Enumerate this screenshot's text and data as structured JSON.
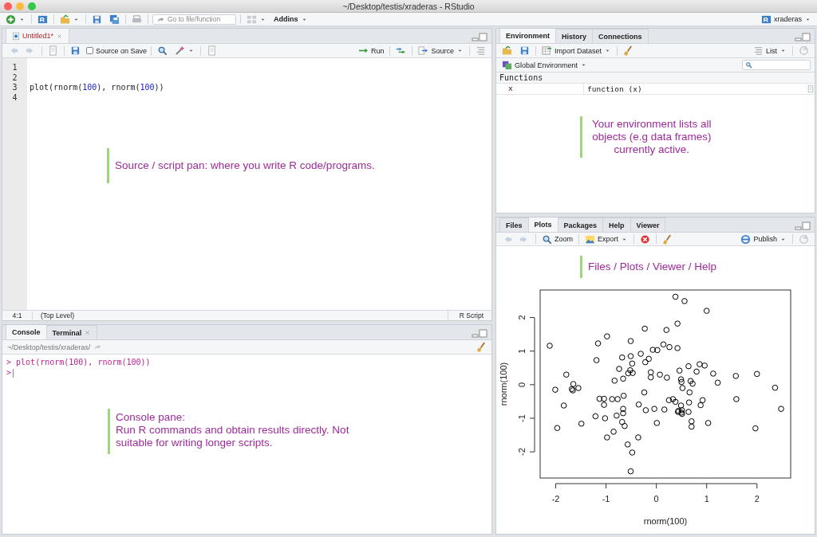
{
  "window": {
    "title": "~/Desktop/testis/xraderas - RStudio"
  },
  "toolbar": {
    "goto_placeholder": "Go to file/function",
    "addins": "Addins",
    "project": "xraderas"
  },
  "source": {
    "tabs": [
      {
        "label": "Untitled1*",
        "selected": true,
        "modified": true
      }
    ],
    "source_on_save": {
      "label": "Source on Save",
      "checked": false
    },
    "run": "Run",
    "source_button": "Source",
    "lines": [
      {
        "number": "1"
      },
      {
        "number": "2"
      },
      {
        "number": "3",
        "code": [
          {
            "kind": "plain",
            "text": "plot(rnorm("
          },
          {
            "kind": "number",
            "text": "100"
          },
          {
            "kind": "plain",
            "text": "), rnorm("
          },
          {
            "kind": "number",
            "text": "100"
          },
          {
            "kind": "plain",
            "text": "))"
          }
        ]
      },
      {
        "number": "4"
      }
    ],
    "note": [
      "Source / script pan: where you write R code/programs."
    ],
    "status": {
      "position": "4:1",
      "scope": "(Top Level)",
      "type": "R Script"
    }
  },
  "console": {
    "tabs": [
      {
        "label": "Console",
        "selected": true,
        "closable": false
      },
      {
        "label": "Terminal",
        "selected": false,
        "closable": true
      }
    ],
    "path": "~/Desktop/testis/xraderas/",
    "lines": [
      {
        "prompt": ">",
        "text": "plot(rnorm(100), rnorm(100))"
      },
      {
        "prompt": ">"
      }
    ],
    "note": [
      "Console pane:",
      "Run R commands and obtain results directly. Not",
      "suitable for writing longer scripts."
    ]
  },
  "environment": {
    "tabs": [
      {
        "label": "Environment",
        "selected": true
      },
      {
        "label": "History",
        "selected": false
      },
      {
        "label": "Connections",
        "selected": false
      }
    ],
    "import": "Import Dataset",
    "view": "List",
    "scope": "Global Environment",
    "section": "Functions",
    "rows": [
      {
        "name": "x",
        "value": "function (x)"
      }
    ],
    "note": [
      "Your environment lists all",
      "objects (e.g data frames)",
      "currently active."
    ]
  },
  "viewer": {
    "tabs": [
      {
        "label": "Files",
        "selected": false
      },
      {
        "label": "Plots",
        "selected": true
      },
      {
        "label": "Packages",
        "selected": false
      },
      {
        "label": "Help",
        "selected": false
      },
      {
        "label": "Viewer",
        "selected": false
      }
    ],
    "zoom": "Zoom",
    "export": "Export",
    "publish": "Publish",
    "note": [
      "Files / Plots / Viewer / Help"
    ],
    "chart_data": {
      "type": "scatter",
      "xlabel": "rnorm(100)",
      "ylabel": "rnorm(100)",
      "xlim": [
        -2.31,
        2.67
      ],
      "ylim": [
        -2.78,
        2.82
      ],
      "xticks": [
        -2,
        -1,
        0,
        1,
        2
      ],
      "yticks": [
        -2,
        -1,
        0,
        1,
        2
      ],
      "series": [
        {
          "color": "#000000",
          "x": [
            -2.12,
            -2.01,
            -1.97,
            -1.84,
            -1.79,
            -1.68,
            -1.66,
            -1.65,
            -1.55,
            -1.49,
            -1.21,
            -1.19,
            -1.16,
            -1.13,
            -1.04,
            -1.04,
            -1.02,
            -0.98,
            -0.98,
            -0.88,
            -0.85,
            -0.83,
            -0.79,
            -0.77,
            -0.74,
            -0.68,
            -0.68,
            -0.66,
            -0.66,
            -0.66,
            -0.65,
            -0.63,
            -0.57,
            -0.56,
            -0.52,
            -0.51,
            -0.51,
            -0.51,
            -0.48,
            -0.48,
            -0.47,
            -0.36,
            -0.35,
            -0.31,
            -0.24,
            -0.23,
            -0.22,
            -0.21,
            -0.15,
            -0.11,
            -0.11,
            -0.07,
            -0.04,
            0.01,
            0.02,
            0.07,
            0.14,
            0.16,
            0.2,
            0.21,
            0.25,
            0.26,
            0.33,
            0.38,
            0.38,
            0.42,
            0.42,
            0.43,
            0.44,
            0.46,
            0.49,
            0.49,
            0.5,
            0.5,
            0.51,
            0.51,
            0.52,
            0.56,
            0.64,
            0.64,
            0.65,
            0.66,
            0.68,
            0.7,
            0.7,
            0.72,
            0.8,
            0.86,
            0.88,
            0.92,
            0.96,
            1.0,
            1.03,
            1.13,
            1.22,
            1.58,
            1.59,
            1.97,
            2.0,
            2.36,
            2.48
          ],
          "values": [
            1.16,
            -0.15,
            -1.29,
            -0.62,
            0.3,
            -0.13,
            -0.17,
            0.02,
            -0.1,
            -1.16,
            -0.94,
            0.73,
            1.23,
            -0.42,
            -0.42,
            -0.6,
            -1.0,
            -1.57,
            1.44,
            -0.43,
            -1.4,
            0.12,
            -0.92,
            -0.43,
            0.47,
            -1.11,
            0.81,
            0.18,
            -0.85,
            -0.72,
            -0.33,
            -1.23,
            -1.78,
            0.34,
            0.43,
            1.3,
            0.85,
            -2.58,
            0.63,
            -2.02,
            0.35,
            -1.57,
            -0.59,
            0.92,
            -0.23,
            1.67,
            0.67,
            -0.76,
            0.77,
            0.37,
            0.22,
            1.04,
            -0.72,
            -1.14,
            1.03,
            0.3,
            1.2,
            -0.74,
            1.63,
            0.21,
            -0.46,
            1.12,
            -0.43,
            -0.51,
            2.62,
            1.82,
            1.09,
            -0.81,
            -0.78,
            0.42,
            0.16,
            -0.62,
            -0.83,
            0.08,
            -0.76,
            -0.87,
            -0.1,
            2.49,
            0.55,
            -0.81,
            -0.53,
            -0.23,
            0.11,
            -1.09,
            -1.25,
            0.03,
            0.39,
            0.61,
            -0.61,
            -0.46,
            0.57,
            2.2,
            -1.14,
            0.33,
            0.06,
            0.26,
            -0.43,
            -1.3,
            0.32,
            -0.09,
            -0.72
          ]
        }
      ]
    }
  }
}
